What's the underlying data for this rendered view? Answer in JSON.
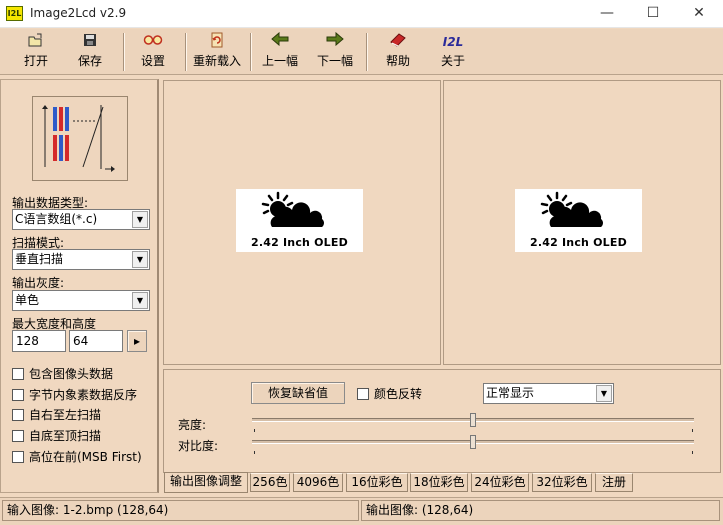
{
  "window": {
    "app_icon_label": "I2L",
    "title": "Image2Lcd v2.9",
    "minimize_glyph": "—",
    "maximize_glyph": "☐",
    "close_glyph": "✕"
  },
  "toolbar": {
    "open": "打开",
    "save": "保存",
    "settings": "设置",
    "reload": "重新载入",
    "prev": "上一幅",
    "next": "下一幅",
    "help": "帮助",
    "about": "关于",
    "about_icon_text": "I2L"
  },
  "left": {
    "output_type_label": "输出数据类型:",
    "output_type_value": "C语言数组(*.c)",
    "scan_mode_label": "扫描模式:",
    "scan_mode_value": "垂直扫描",
    "gray_label": "输出灰度:",
    "gray_value": "单色",
    "max_size_label": "最大宽度和高度",
    "max_width": "128",
    "max_height": "64",
    "apply_glyph": "▸",
    "checkboxes": [
      {
        "label": "包含图像头数据",
        "checked": false
      },
      {
        "label": "字节内象素数据反序",
        "checked": false
      },
      {
        "label": "自右至左扫描",
        "checked": false
      },
      {
        "label": "自底至顶扫描",
        "checked": false
      },
      {
        "label": "高位在前(MSB First)",
        "checked": false
      }
    ]
  },
  "images": {
    "input_caption": "2.42 Inch OLED",
    "output_caption": "2.42 Inch OLED"
  },
  "controls": {
    "restore_default": "恢复缺省值",
    "invert_label": "颜色反转",
    "display_mode": "正常显示",
    "brightness_label": "亮度:",
    "contrast_label": "对比度:",
    "brightness_level": 0.5,
    "contrast_level": 0.5
  },
  "tabs": [
    "输出图像调整",
    "256色",
    "4096色",
    "16位彩色",
    "18位彩色",
    "24位彩色",
    "32位彩色",
    "注册"
  ],
  "status": {
    "input": "输入图像: 1-2.bmp (128,64)",
    "output": "输出图像: (128,64)"
  },
  "colors": {
    "panel_bg": "#f0d8c0",
    "toolbar_bg": "#ecd4bc",
    "arrow_green": "#4a6a1a",
    "scan_blue": "#2e5bc9",
    "scan_red": "#d42a2a"
  }
}
